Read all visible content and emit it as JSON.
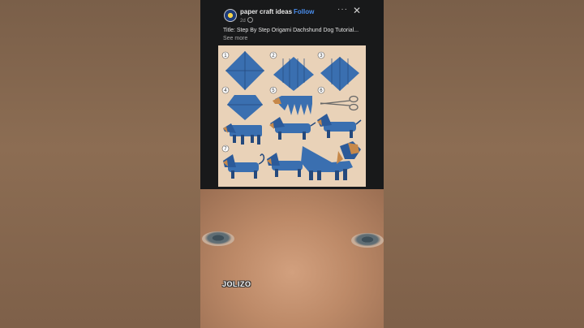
{
  "post": {
    "page_name": "paper craft ideas",
    "follow_label": "Follow",
    "time": "2d",
    "more_glyph": "···",
    "close_glyph": "✕",
    "caption": "Title: Step By Step Origami Dachshund Dog Tutorial...",
    "see_more": "See more",
    "step_numbers": [
      "1",
      "2",
      "3",
      "4",
      "5",
      "6",
      "7"
    ]
  },
  "video": {
    "watermark": "JOLIZO"
  },
  "colors": {
    "paper_blue": "#3a6fb0",
    "paper_dark": "#24497d",
    "accent_tan": "#c6884a",
    "follow_blue": "#4a8ff0"
  }
}
